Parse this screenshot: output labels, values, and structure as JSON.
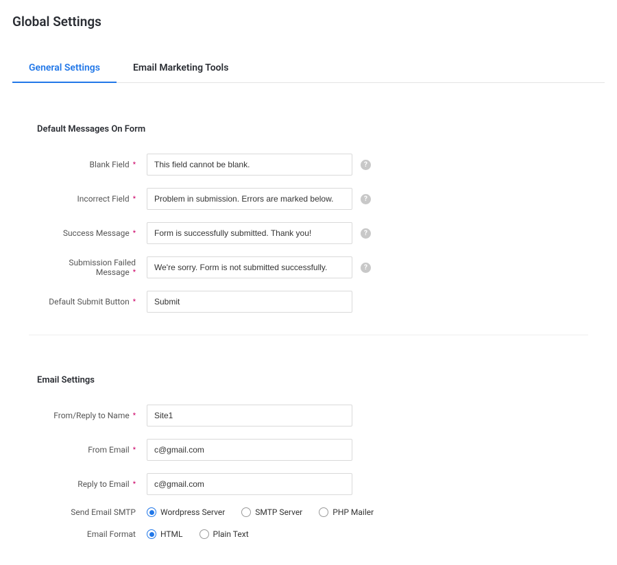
{
  "page_title": "Global Settings",
  "tabs": [
    {
      "label": "General Settings",
      "active": true
    },
    {
      "label": "Email Marketing Tools",
      "active": false
    }
  ],
  "messages_section": {
    "title": "Default Messages On Form",
    "blank_field": {
      "label": "Blank Field",
      "value": "This field cannot be blank."
    },
    "incorrect_field": {
      "label": "Incorrect Field",
      "value": "Problem in submission. Errors are marked below."
    },
    "success_message": {
      "label": "Success Message",
      "value": "Form is successfully submitted. Thank you!"
    },
    "submission_failed": {
      "label": "Submission Failed Message",
      "value": "We're sorry. Form is not submitted successfully."
    },
    "default_submit": {
      "label": "Default Submit Button",
      "value": "Submit"
    }
  },
  "email_section": {
    "title": "Email Settings",
    "from_name": {
      "label": "From/Reply to Name",
      "value": "Site1"
    },
    "from_email": {
      "label": "From Email",
      "value": "c@gmail.com"
    },
    "reply_email": {
      "label": "Reply to Email",
      "value": "c@gmail.com"
    },
    "smtp": {
      "label": "Send Email SMTP",
      "options": [
        {
          "label": "Wordpress Server",
          "checked": true
        },
        {
          "label": "SMTP Server",
          "checked": false
        },
        {
          "label": "PHP Mailer",
          "checked": false
        }
      ]
    },
    "format": {
      "label": "Email Format",
      "options": [
        {
          "label": "HTML",
          "checked": true
        },
        {
          "label": "Plain Text",
          "checked": false
        }
      ]
    }
  }
}
